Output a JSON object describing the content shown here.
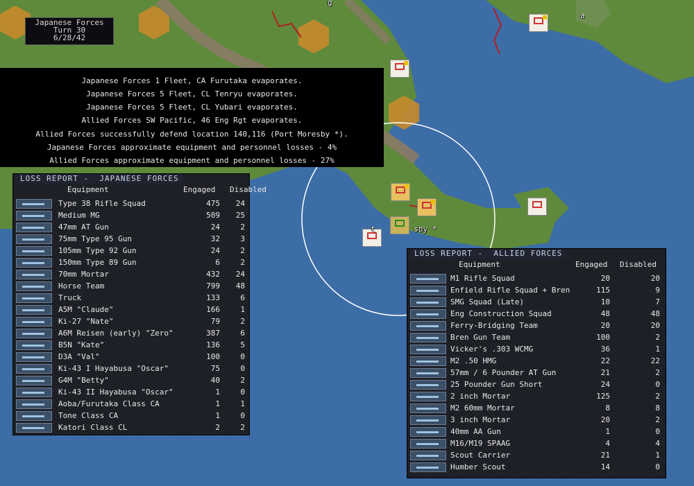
{
  "turn_box": {
    "side": "Japanese Forces",
    "turn": "Turn 30",
    "date": "6/28/42"
  },
  "messages": [
    "Japanese Forces 1 Fleet, CA Furutaka evaporates.",
    "Japanese Forces 5 Fleet, CL Tenryu evaporates.",
    "Japanese Forces 5 Fleet, CL Yubari evaporates.",
    "Allied Forces SW Pacific, 46 Eng Rgt evaporates.",
    "Allied Forces successfully defend location 140,116 (Port Moresby *).",
    "Japanese Forces approximate equipment and personnel losses - 4%",
    "Allied Forces approximate equipment and personnel losses - 27%"
  ],
  "map_labels": {
    "port": "sby *",
    "port_prefix": "t",
    "top_label": "g",
    "city_label": "a"
  },
  "japanese_report": {
    "title": "LOSS REPORT -  JAPANESE FORCES",
    "headers": {
      "equipment": "Equipment",
      "engaged": "Engaged",
      "disabled": "Disabled"
    },
    "rows": [
      {
        "name": "Type 38 Rifle Squad",
        "engaged": "475",
        "disabled": "24"
      },
      {
        "name": "Medium MG",
        "engaged": "509",
        "disabled": "25"
      },
      {
        "name": "47mm AT Gun",
        "engaged": "24",
        "disabled": "2"
      },
      {
        "name": "75mm Type 95 Gun",
        "engaged": "32",
        "disabled": "3"
      },
      {
        "name": "105mm Type 92 Gun",
        "engaged": "24",
        "disabled": "2"
      },
      {
        "name": "150mm Type 89 Gun",
        "engaged": "6",
        "disabled": "2"
      },
      {
        "name": "70mm Mortar",
        "engaged": "432",
        "disabled": "24"
      },
      {
        "name": "Horse Team",
        "engaged": "799",
        "disabled": "48"
      },
      {
        "name": "Truck",
        "engaged": "133",
        "disabled": "6"
      },
      {
        "name": "A5M \"Claude\"",
        "engaged": "166",
        "disabled": "1"
      },
      {
        "name": "Ki-27 \"Nate\"",
        "engaged": "79",
        "disabled": "2"
      },
      {
        "name": "A6M Reisen (early) \"Zero\"",
        "engaged": "387",
        "disabled": "6"
      },
      {
        "name": "B5N \"Kate\"",
        "engaged": "136",
        "disabled": "5"
      },
      {
        "name": "D3A \"Val\"",
        "engaged": "100",
        "disabled": "0"
      },
      {
        "name": "Ki-43 I Hayabusa \"Oscar\"",
        "engaged": "75",
        "disabled": "0"
      },
      {
        "name": "G4M \"Betty\"",
        "engaged": "40",
        "disabled": "2"
      },
      {
        "name": "Ki-43 II Hayabusa \"Oscar\"",
        "engaged": "1",
        "disabled": "0"
      },
      {
        "name": "Aoba/Furutaka Class CA",
        "engaged": "1",
        "disabled": "1"
      },
      {
        "name": "Tone Class CA",
        "engaged": "1",
        "disabled": "0"
      },
      {
        "name": "Katori Class CL",
        "engaged": "2",
        "disabled": "2"
      }
    ]
  },
  "allied_report": {
    "title": "LOSS REPORT -  ALLIED FORCES",
    "headers": {
      "equipment": "Equipment",
      "engaged": "Engaged",
      "disabled": "Disabled"
    },
    "rows": [
      {
        "name": "M1 Rifle Squad",
        "engaged": "20",
        "disabled": "20"
      },
      {
        "name": "Enfield Rifle Squad + Bren",
        "engaged": "115",
        "disabled": "9"
      },
      {
        "name": "SMG Squad (Late)",
        "engaged": "10",
        "disabled": "7"
      },
      {
        "name": "Eng Construction Squad",
        "engaged": "48",
        "disabled": "48"
      },
      {
        "name": "Ferry-Bridging Team",
        "engaged": "20",
        "disabled": "20"
      },
      {
        "name": "Bren Gun Team",
        "engaged": "100",
        "disabled": "2"
      },
      {
        "name": "Vicker's .303 WCMG",
        "engaged": "36",
        "disabled": "1"
      },
      {
        "name": "M2 .50 HMG",
        "engaged": "22",
        "disabled": "22"
      },
      {
        "name": "57mm / 6 Pounder AT Gun",
        "engaged": "21",
        "disabled": "2"
      },
      {
        "name": "25 Pounder Gun Short",
        "engaged": "24",
        "disabled": "0"
      },
      {
        "name": "2 inch Mortar",
        "engaged": "125",
        "disabled": "2"
      },
      {
        "name": "M2 60mm Mortar",
        "engaged": "8",
        "disabled": "8"
      },
      {
        "name": "3 inch Mortar",
        "engaged": "20",
        "disabled": "2"
      },
      {
        "name": "40mm AA Gun",
        "engaged": "1",
        "disabled": "0"
      },
      {
        "name": "M16/M19 SPAAG",
        "engaged": "4",
        "disabled": "4"
      },
      {
        "name": "Scout Carrier",
        "engaged": "21",
        "disabled": "1"
      },
      {
        "name": "Humber Scout",
        "engaged": "14",
        "disabled": "0"
      }
    ]
  },
  "colors": {
    "sea": "#3a6aa0",
    "land": "#5f8a3c",
    "hex_land": "#c78a2a",
    "mountain": "#8a7a66",
    "panel": "#1b1d24",
    "text": "#e8e8e8"
  }
}
